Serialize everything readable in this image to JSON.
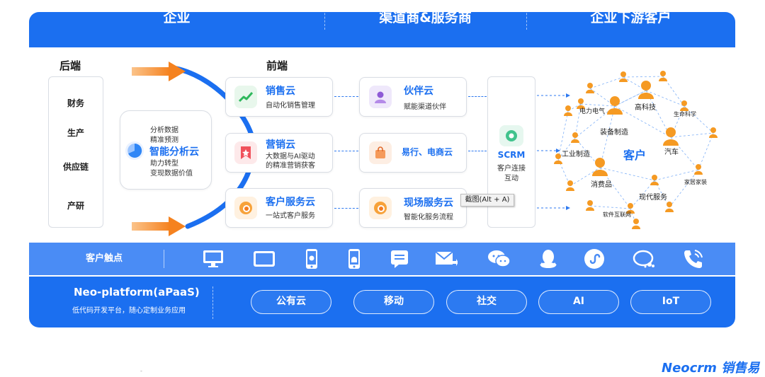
{
  "header": {
    "enterprise": "企业",
    "channel": "渠道商&服务商",
    "downstream": "企业下游客户"
  },
  "backend": {
    "label": "后端",
    "items": [
      "财务",
      "生产",
      "供应链",
      "产研"
    ]
  },
  "analysis": {
    "line1": "分析数据",
    "line2": "精准预测",
    "title": "智能分析云",
    "line3": "助力转型",
    "line4": "变现数据价值"
  },
  "frontend": {
    "label": "前端",
    "sales": {
      "title": "销售云",
      "sub": "自动化销售管理"
    },
    "marketing": {
      "title": "营销云",
      "sub1": "大数据与AI驱动",
      "sub2": "的精准营销获客"
    },
    "service": {
      "title": "客户服务云",
      "sub": "一站式客户服务"
    }
  },
  "channel_cards": {
    "partner": {
      "title": "伙伴云",
      "sub": "赋能渠道伙伴"
    },
    "ecommerce": {
      "title": "易行、电商云"
    },
    "field": {
      "title": "现场服务云",
      "sub": "智能化服务流程"
    }
  },
  "scrm": {
    "title": "SCRM",
    "sub1": "客户连接",
    "sub2": "互动"
  },
  "customers": {
    "center": "客户",
    "labels": [
      "电力电气",
      "高科技",
      "生命科学",
      "装备制造",
      "工业制造",
      "汽车",
      "消费品",
      "家居家装",
      "现代服务",
      "软件互联网"
    ]
  },
  "tooltip": "截图(Alt + A)",
  "touchpoints": {
    "label": "客户触点",
    "icons": [
      "desktop-icon",
      "tablet-icon",
      "iphone-icon",
      "android-icon",
      "message-icon",
      "email-icon",
      "wechat-icon",
      "qq-icon",
      "miniprogram-icon",
      "chat-icon",
      "phone-icon"
    ]
  },
  "platform": {
    "title": "Neo-platform(aPaaS)",
    "sub": "低代码开发平台，随心定制业务应用",
    "pills": [
      "公有云",
      "移动",
      "社交",
      "AI",
      "IoT"
    ]
  },
  "brand": "Neocrm 销售易",
  "colors": {
    "primary": "#1b6ff0",
    "touch_band": "#4a8cf5",
    "arrow": "#f5821f",
    "person": "#f59a23"
  }
}
